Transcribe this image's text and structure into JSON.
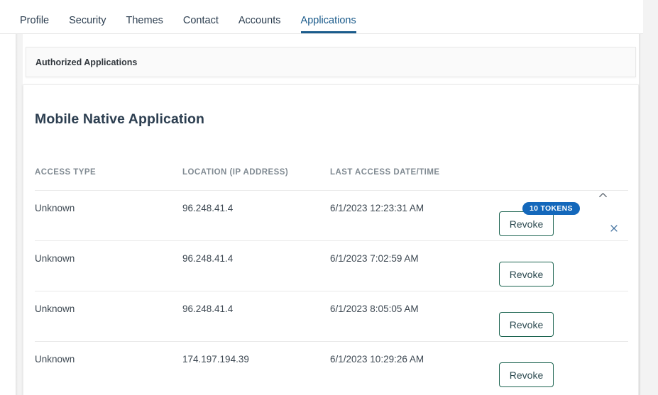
{
  "tabs": [
    {
      "label": "Profile",
      "active": false
    },
    {
      "label": "Security",
      "active": false
    },
    {
      "label": "Themes",
      "active": false
    },
    {
      "label": "Contact",
      "active": false
    },
    {
      "label": "Accounts",
      "active": false
    },
    {
      "label": "Applications",
      "active": true
    }
  ],
  "section": {
    "header_label": "Authorized Applications"
  },
  "application": {
    "name": "Mobile Native Application",
    "token_badge": "10 TOKENS",
    "collapse_icon": "chevron-up-icon",
    "close_icon": "close-icon"
  },
  "table": {
    "columns": [
      "ACCESS TYPE",
      "LOCATION (IP ADDRESS)",
      "LAST ACCESS DATE/TIME",
      ""
    ],
    "action_label": "Revoke",
    "rows": [
      {
        "access_type": "Unknown",
        "location": "96.248.41.4",
        "last_access": "6/1/2023 12:23:31 AM",
        "action": "Revoke"
      },
      {
        "access_type": "Unknown",
        "location": "96.248.41.4",
        "last_access": "6/1/2023 7:02:59 AM",
        "action": "Revoke"
      },
      {
        "access_type": "Unknown",
        "location": "96.248.41.4",
        "last_access": "6/1/2023 8:05:05 AM",
        "action": "Revoke"
      },
      {
        "access_type": "Unknown",
        "location": "174.197.194.39",
        "last_access": "6/1/2023 10:29:26 AM",
        "action": "Revoke"
      }
    ]
  },
  "colors": {
    "accent_tab": "#1b5c8c",
    "badge_blue": "#1468bb",
    "revoke_border": "#1c6450",
    "close_icon": "#3f6f9e",
    "header_bg": "#fafafa"
  }
}
